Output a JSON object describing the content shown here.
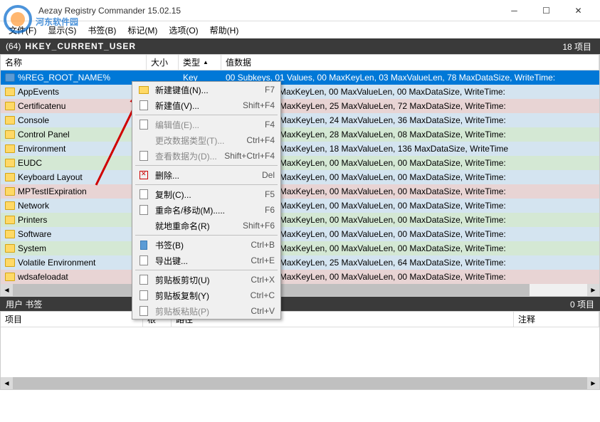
{
  "window": {
    "title": "Aezay Registry Commander 15.02.15"
  },
  "watermark_text": "河东软件园",
  "menubar": {
    "items": [
      {
        "label": "文件(F)"
      },
      {
        "label": "显示(S)"
      },
      {
        "label": "书签(B)"
      },
      {
        "label": "标记(M)"
      },
      {
        "label": "选项(O)"
      },
      {
        "label": "帮助(H)"
      }
    ]
  },
  "pathbar": {
    "prefix": "(64)",
    "path": "HKEY_CURRENT_USER",
    "count": "18 项目"
  },
  "columns": {
    "name": "名称",
    "size": "大小",
    "type": "类型",
    "data": "值数据"
  },
  "rows": [
    {
      "name": "%REG_ROOT_NAME%",
      "type": "Key",
      "data": "00 Subkeys, 01 Values, 00 MaxKeyLen, 03 MaxValueLen, 78 MaxDataSize, WriteTime:",
      "cls": "selected",
      "icon": "key"
    },
    {
      "name": "AppEvents",
      "type": "",
      "data": "00 Values, 11 MaxKeyLen, 00 MaxValueLen, 00 MaxDataSize, WriteTime:",
      "cls": "hl3",
      "icon": "folder"
    },
    {
      "name": "Certificatenu",
      "type": "",
      "data": "00 Values, 14 MaxKeyLen, 25 MaxValueLen, 72 MaxDataSize, WriteTime:",
      "cls": "hl2",
      "icon": "folder"
    },
    {
      "name": "Console",
      "type": "",
      "data": "34 Values, 59 MaxKeyLen, 24 MaxValueLen, 36 MaxDataSize, WriteTime:",
      "cls": "hl3",
      "icon": "folder"
    },
    {
      "name": "Control Panel",
      "type": "",
      "data": "01 Values, 15 MaxKeyLen, 28 MaxValueLen, 08 MaxDataSize, WriteTime:",
      "cls": "hl1",
      "icon": "folder"
    },
    {
      "name": "Environment",
      "type": "",
      "data": "05 Values, 00 MaxKeyLen, 18 MaxValueLen, 136 MaxDataSize, WriteTime",
      "cls": "hl3",
      "icon": "folder"
    },
    {
      "name": "EUDC",
      "type": "",
      "data": "00 Values, 03 MaxKeyLen, 00 MaxValueLen, 00 MaxDataSize, WriteTime:",
      "cls": "hl1",
      "icon": "folder"
    },
    {
      "name": "Keyboard Layout",
      "type": "",
      "data": "00 Values, 10 MaxKeyLen, 00 MaxValueLen, 00 MaxDataSize, WriteTime:",
      "cls": "hl3",
      "icon": "folder"
    },
    {
      "name": "MPTestIExpiration",
      "type": "",
      "data": "00 Values, 00 MaxKeyLen, 00 MaxValueLen, 00 MaxDataSize, WriteTime:",
      "cls": "hl2",
      "icon": "folder"
    },
    {
      "name": "Network",
      "type": "",
      "data": "00 Values, 00 MaxKeyLen, 00 MaxValueLen, 00 MaxDataSize, WriteTime:",
      "cls": "hl3",
      "icon": "folder"
    },
    {
      "name": "Printers",
      "type": "",
      "data": "00 Values, 14 MaxKeyLen, 00 MaxValueLen, 00 MaxDataSize, WriteTime:",
      "cls": "hl1",
      "icon": "folder"
    },
    {
      "name": "Software",
      "type": "",
      "data": "00 Values, 38 MaxKeyLen, 00 MaxValueLen, 00 MaxDataSize, WriteTime:",
      "cls": "hl3",
      "icon": "folder"
    },
    {
      "name": "System",
      "type": "",
      "data": "00 Values, 17 MaxKeyLen, 00 MaxValueLen, 00 MaxDataSize, WriteTime:",
      "cls": "hl1",
      "icon": "folder"
    },
    {
      "name": "Volatile Environment",
      "type": "",
      "data": "08 Values, 01 MaxKeyLen, 25 MaxValueLen, 64 MaxDataSize, WriteTime:",
      "cls": "hl3",
      "icon": "folder"
    },
    {
      "name": "wdsafeloadat",
      "type": "",
      "data": "00 Values, 15 MaxKeyLen, 00 MaxValueLen, 00 MaxDataSize, WriteTime:",
      "cls": "hl2",
      "icon": "folder"
    }
  ],
  "context_menu": {
    "items": [
      {
        "label": "新建键值(N)...",
        "shortcut": "F7",
        "icon": "folder"
      },
      {
        "label": "新建值(V)...",
        "shortcut": "Shift+F4",
        "icon": "doc"
      },
      {
        "sep": true
      },
      {
        "label": "编辑值(E)...",
        "shortcut": "F4",
        "disabled": true,
        "icon": "doc"
      },
      {
        "label": "更改数据类型(T)...",
        "shortcut": "Ctrl+F4",
        "disabled": true
      },
      {
        "label": "查看数据为(D)...",
        "shortcut": "Shift+Ctrl+F4",
        "disabled": true,
        "icon": "doc"
      },
      {
        "sep": true
      },
      {
        "label": "删除...",
        "shortcut": "Del",
        "icon": "del"
      },
      {
        "sep": true
      },
      {
        "label": "复制(C)...",
        "shortcut": "F5",
        "icon": "doc"
      },
      {
        "label": "重命名/移动(M).....",
        "shortcut": "F6",
        "icon": "doc"
      },
      {
        "label": "就地重命名(R)",
        "shortcut": "Shift+F6"
      },
      {
        "sep": true
      },
      {
        "label": "书签(B)",
        "shortcut": "Ctrl+B",
        "icon": "book"
      },
      {
        "label": "导出键...",
        "shortcut": "Ctrl+E",
        "icon": "doc"
      },
      {
        "sep": true
      },
      {
        "label": "剪贴板剪切(U)",
        "shortcut": "Ctrl+X",
        "icon": "doc"
      },
      {
        "label": "剪贴板复制(Y)",
        "shortcut": "Ctrl+C",
        "icon": "doc"
      },
      {
        "label": "剪贴板粘贴(P)",
        "shortcut": "Ctrl+V",
        "disabled": true,
        "icon": "doc"
      }
    ]
  },
  "bottom": {
    "title": "用户 书签",
    "count": "0 项目",
    "cols": {
      "project": "项目",
      "root": "根",
      "path": "路径",
      "note": "注释"
    }
  }
}
